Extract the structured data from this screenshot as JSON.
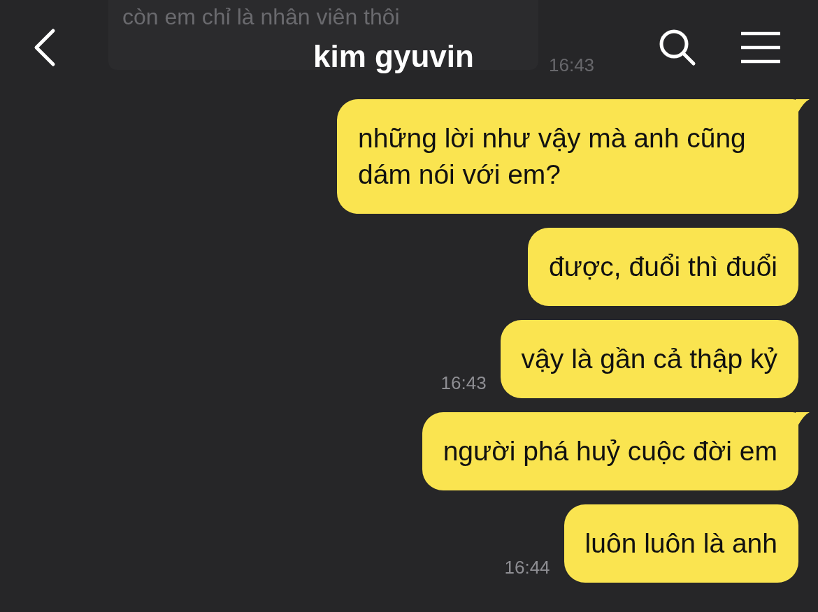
{
  "header": {
    "title": "kim gyuvin"
  },
  "behind_header": {
    "text": "còn em chỉ là nhân viên thôi",
    "time": "16:43"
  },
  "messages": [
    {
      "text": "những lời như vậy mà anh cũng dám nói với em?",
      "tail": true
    },
    {
      "text": "được, đuổi thì đuổi",
      "tail": false
    },
    {
      "text": "vậy là gần cả thập kỷ",
      "tail": false,
      "time": "16:43"
    },
    {
      "text": "người phá huỷ cuộc đời em",
      "tail": true
    },
    {
      "text": "luôn luôn là anh",
      "tail": false,
      "time": "16:44"
    }
  ]
}
